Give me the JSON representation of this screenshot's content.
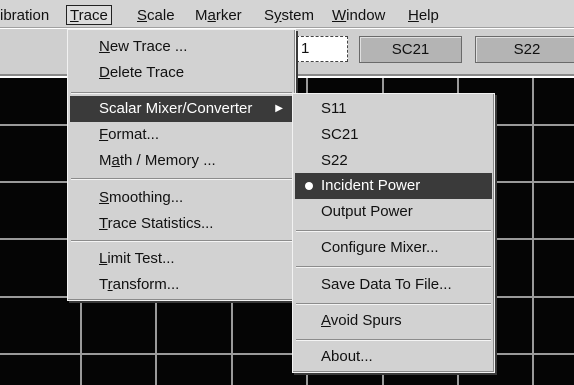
{
  "menubar": {
    "items": [
      {
        "label": "ibration"
      },
      {
        "label": "Trace",
        "u": "T",
        "rest": "race"
      },
      {
        "label": "Scale",
        "u": "S",
        "rest": "cale"
      },
      {
        "label": "Marker",
        "pre": "M",
        "u": "a",
        "rest": "rker"
      },
      {
        "label": "System",
        "pre": "S",
        "u": "y",
        "rest": "stem"
      },
      {
        "label": "Window",
        "u": "W",
        "rest": "indow"
      },
      {
        "label": "Help",
        "u": "H",
        "rest": "elp"
      }
    ]
  },
  "toolbar": {
    "field_value": "1",
    "buttons": [
      "SC21",
      "S22"
    ]
  },
  "trace_menu": {
    "new_trace": {
      "u": "N",
      "rest": "ew Trace ..."
    },
    "delete_trace": {
      "u": "D",
      "rest": "elete Trace"
    },
    "scalar_mixer": {
      "label": "Scalar Mixer/Converter"
    },
    "format": {
      "u": "F",
      "rest": "ormat..."
    },
    "math_memory": {
      "pre": "M",
      "u": "a",
      "rest": "th / Memory ..."
    },
    "smoothing": {
      "u": "S",
      "rest": "moothing..."
    },
    "trace_statistics": {
      "u": "T",
      "rest": "race Statistics..."
    },
    "limit_test": {
      "u": "L",
      "rest": "imit Test..."
    },
    "transform": {
      "pre": "T",
      "u": "r",
      "rest": "ansform..."
    }
  },
  "submenu": {
    "s11": "S11",
    "sc21": "SC21",
    "s22": "S22",
    "incident_power": "Incident Power",
    "output_power": "Output Power",
    "configure_mixer": "Configure Mixer...",
    "save_data": "Save Data To File...",
    "avoid_spurs": {
      "u": "A",
      "rest": "void Spurs"
    },
    "about": "About..."
  },
  "colors": {
    "menu_bg": "#d2d2d2",
    "highlight": "#3a3a3a",
    "plot_bg": "#050505",
    "grid": "#9a9a9a"
  },
  "icons": {
    "submenu_arrow": "triangle-right-icon",
    "radio_bullet": "bullet-icon"
  }
}
